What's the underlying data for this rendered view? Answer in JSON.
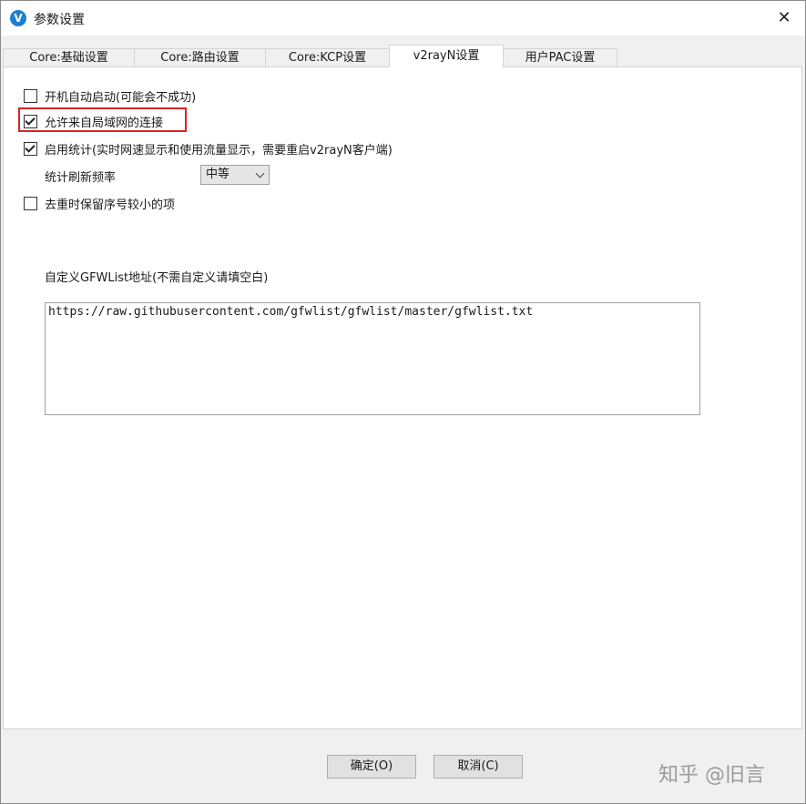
{
  "window": {
    "title": "参数设置",
    "close_glyph": "✕",
    "app_icon_glyph": "V"
  },
  "tabs": [
    {
      "label": "Core:基础设置",
      "active": false
    },
    {
      "label": "Core:路由设置",
      "active": false
    },
    {
      "label": "Core:KCP设置",
      "active": false
    },
    {
      "label": "v2rayN设置",
      "active": true
    },
    {
      "label": "用户PAC设置",
      "active": false
    }
  ],
  "options": {
    "autostart": {
      "label": "开机自动启动(可能会不成功)",
      "checked": false
    },
    "allow_lan": {
      "label": "允许来自局域网的连接",
      "checked": true
    },
    "statistics": {
      "label": "启用统计(实时网速显示和使用流量显示，需要重启v2rayN客户端)",
      "checked": true
    },
    "refresh_rate": {
      "label": "统计刷新频率",
      "value": "中等"
    },
    "dedupe": {
      "label": "去重时保留序号较小的项",
      "checked": false
    }
  },
  "gfwlist": {
    "label": "自定义GFWList地址(不需自定义请填空白)",
    "value": "https://raw.githubusercontent.com/gfwlist/gfwlist/master/gfwlist.txt"
  },
  "buttons": {
    "ok": "确定(O)",
    "cancel": "取消(C)"
  },
  "watermark": "知乎 @旧言",
  "colors": {
    "highlight": "#e02020",
    "app_icon": "#1e7fd0"
  }
}
